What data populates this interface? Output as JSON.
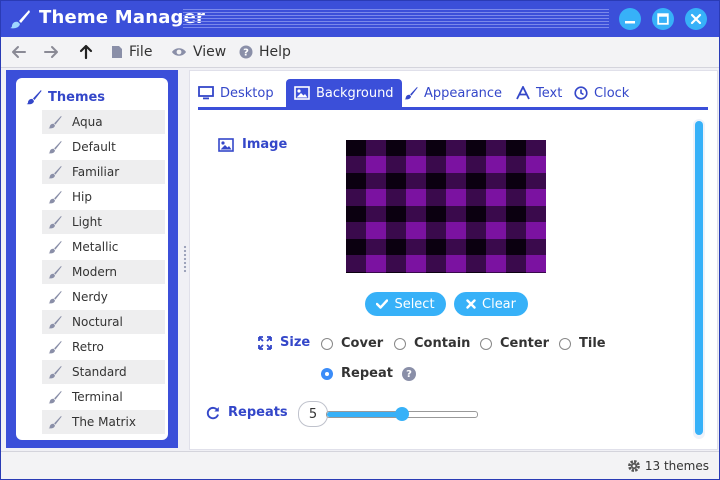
{
  "app": {
    "title": "Theme Manager"
  },
  "colors": {
    "accent": "#3b4fd9",
    "button": "#37b1f8",
    "preview_check": "#6b0d8a"
  },
  "menu": {
    "file": "File",
    "view": "View",
    "help": "Help"
  },
  "sidebar": {
    "header": "Themes",
    "items": [
      "Aqua",
      "Default",
      "Familiar",
      "Hip",
      "Light",
      "Metallic",
      "Modern",
      "Nerdy",
      "Noctural",
      "Retro",
      "Standard",
      "Terminal",
      "The Matrix"
    ]
  },
  "tabs": [
    {
      "label": "Desktop",
      "icon": "monitor-icon"
    },
    {
      "label": "Background",
      "icon": "image-icon",
      "active": true
    },
    {
      "label": "Appearance",
      "icon": "brush-icon"
    },
    {
      "label": "Text",
      "icon": "font-icon"
    },
    {
      "label": "Clock",
      "icon": "clock-icon"
    }
  ],
  "background": {
    "image_label": "Image",
    "select_label": "Select",
    "clear_label": "Clear",
    "size_label": "Size",
    "size_options": [
      "Cover",
      "Contain",
      "Center",
      "Tile",
      "Repeat"
    ],
    "size_selected": "Repeat",
    "help": "?",
    "repeats_label": "Repeats",
    "repeats_value": "5",
    "repeats_fraction": 0.5
  },
  "status": {
    "text": "13 themes"
  }
}
